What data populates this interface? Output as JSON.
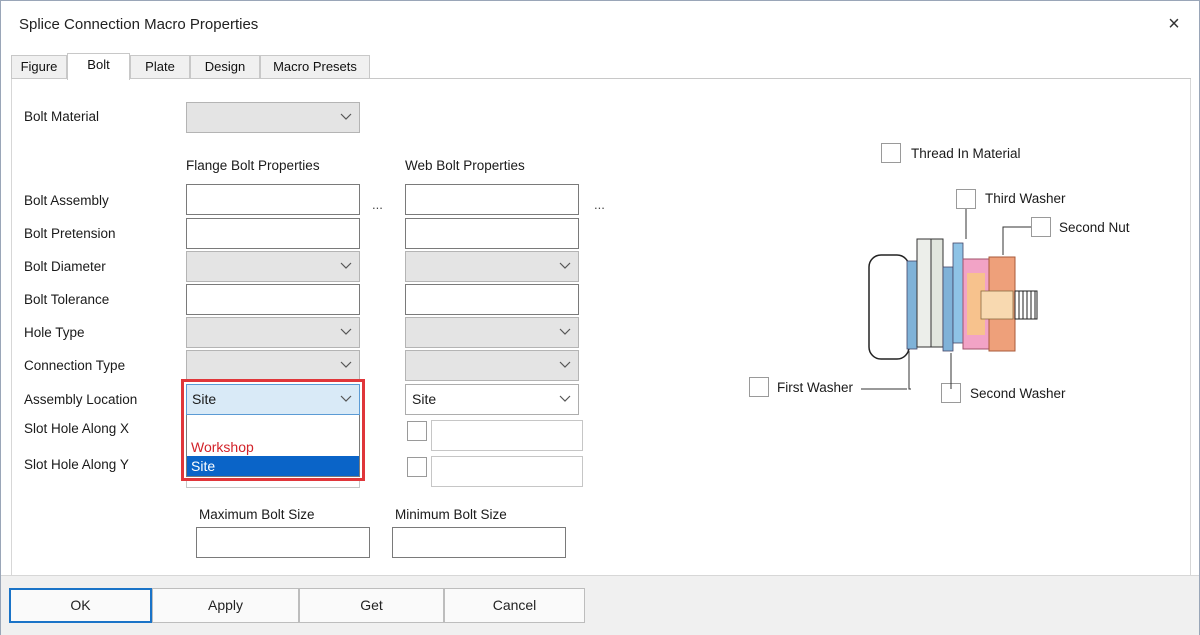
{
  "window": {
    "title": "Splice Connection Macro Properties",
    "close_glyph": "×"
  },
  "tabs": [
    "Figure",
    "Bolt",
    "Plate",
    "Design",
    "Macro Presets"
  ],
  "active_tab": "Bolt",
  "bolt_material": {
    "label": "Bolt Material",
    "value": ""
  },
  "columns": {
    "flange": "Flange Bolt Properties",
    "web": "Web Bolt Properties"
  },
  "rows": {
    "bolt_assembly": "Bolt Assembly",
    "bolt_pretension": "Bolt Pretension",
    "bolt_diameter": "Bolt Diameter",
    "bolt_tolerance": "Bolt Tolerance",
    "hole_type": "Hole Type",
    "connection_type": "Connection Type",
    "assembly_location": "Assembly Location",
    "slot_hole_x": "Slot Hole Along X",
    "slot_hole_y": "Slot Hole Along Y"
  },
  "ellipsis": "...",
  "assembly_location": {
    "flange_value": "Site",
    "web_value": "Site",
    "options": [
      "Workshop",
      "Site"
    ],
    "selected": "Site"
  },
  "bolt_size": {
    "max_label": "Maximum Bolt Size",
    "min_label": "Minimum Bolt Size"
  },
  "diagram": {
    "thread_in_material": "Thread In Material",
    "third_washer": "Third Washer",
    "second_nut": "Second Nut",
    "first_washer": "First Washer",
    "second_washer": "Second Washer"
  },
  "buttons": {
    "ok": "OK",
    "apply": "Apply",
    "get": "Get",
    "cancel": "Cancel"
  },
  "colors": {
    "highlight": "#e0363a",
    "selection": "#0a64c8",
    "workshop_text": "#d2232a"
  }
}
